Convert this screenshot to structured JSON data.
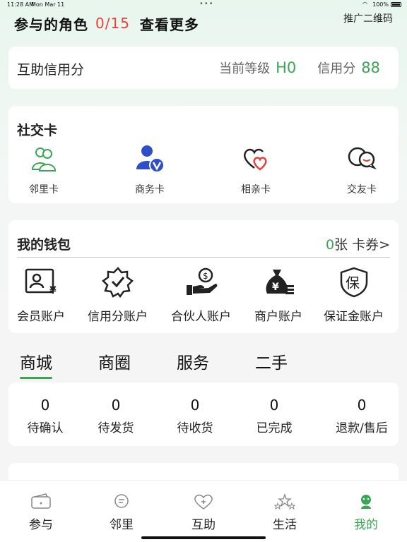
{
  "status_bar": {
    "time": "11:28 AM",
    "date": "Mon Mar 11",
    "battery": "100%"
  },
  "header": {
    "role_title": "参与的角色",
    "role_count": "0/15",
    "view_more": "查看更多",
    "qr_link": "推广二维码"
  },
  "credit": {
    "title": "互助信用分",
    "level_label": "当前等级",
    "level_value": "H0",
    "score_label": "信用分",
    "score_value": "88"
  },
  "social": {
    "title": "社交卡",
    "items": [
      {
        "label": "邻里卡",
        "icon": "neighbors-icon"
      },
      {
        "label": "商务卡",
        "icon": "business-user-icon"
      },
      {
        "label": "相亲卡",
        "icon": "hearts-icon"
      },
      {
        "label": "交友卡",
        "icon": "chat-bubbles-icon"
      }
    ]
  },
  "wallet": {
    "title": "我的钱包",
    "coupon_count": "0",
    "coupon_label": "张 卡券>",
    "items": [
      {
        "label": "会员账户",
        "icon": "member-card-icon"
      },
      {
        "label": "信用分账户",
        "icon": "badge-check-icon"
      },
      {
        "label": "合伙人账户",
        "icon": "hand-coin-icon"
      },
      {
        "label": "商户账户",
        "icon": "money-bag-icon"
      },
      {
        "label": "保证金账户",
        "icon": "shield-bao-icon"
      }
    ]
  },
  "tabs": [
    {
      "label": "商城",
      "active": true
    },
    {
      "label": "商圈",
      "active": false
    },
    {
      "label": "服务",
      "active": false
    },
    {
      "label": "二手",
      "active": false
    }
  ],
  "orders": [
    {
      "count": "0",
      "label": "待确认"
    },
    {
      "count": "0",
      "label": "待发货"
    },
    {
      "count": "0",
      "label": "待收货"
    },
    {
      "count": "0",
      "label": "已完成"
    },
    {
      "count": "0",
      "label": "退款/售后"
    }
  ],
  "bottom_nav": [
    {
      "label": "参与",
      "icon": "wallet-icon",
      "active": false
    },
    {
      "label": "邻里",
      "icon": "chat-icon",
      "active": false
    },
    {
      "label": "互助",
      "icon": "heart-plus-icon",
      "active": false
    },
    {
      "label": "生活",
      "icon": "stars-icon",
      "active": false
    },
    {
      "label": "我的",
      "icon": "profile-icon",
      "active": true
    }
  ],
  "colors": {
    "accent": "#3aa655",
    "highlight": "#e3433a",
    "business_blue": "#2e4fc9"
  }
}
